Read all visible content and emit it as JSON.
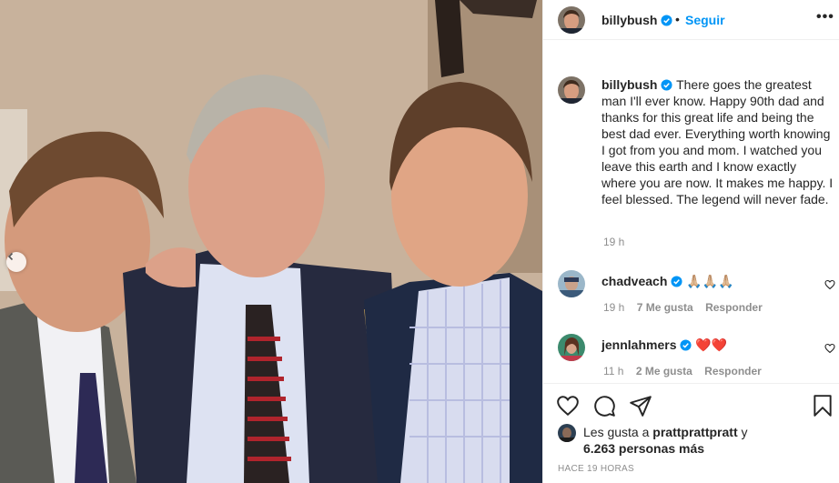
{
  "header": {
    "username": "billybush",
    "separator": "•",
    "follow_label": "Seguir",
    "more_label": "•••"
  },
  "caption": {
    "username": "billybush",
    "text": "There goes the greatest man I'll ever know. Happy 90th dad and thanks for this great life and being the best dad ever. Everything worth knowing I got from you and mom. I watched you leave this earth and I know exactly where you are now. It makes me happy. I feel blessed. The legend will never fade.",
    "time": "19 h"
  },
  "comments": [
    {
      "username": "chadveach",
      "text": "🙏🏼🙏🏼🙏🏼",
      "time": "19 h",
      "likes": "7 Me gusta",
      "reply": "Responder"
    },
    {
      "username": "jennlahmers",
      "text": "❤️❤️",
      "time": "11 h",
      "likes": "2 Me gusta",
      "reply": "Responder"
    }
  ],
  "likes": {
    "prefix": "Les gusta a",
    "user": "prattprattpratt",
    "suffix": "y",
    "count": "6.263 personas más"
  },
  "timestamp": "HACE 19 HORAS",
  "icons": [
    "verified-badge-icon",
    "heart-icon",
    "comment-icon",
    "share-icon",
    "bookmark-icon",
    "more-icon",
    "chevron-left-icon"
  ],
  "colors": {
    "accent": "#0095f6",
    "secondary_text": "#8e8e8e",
    "divider": "#efefef"
  }
}
